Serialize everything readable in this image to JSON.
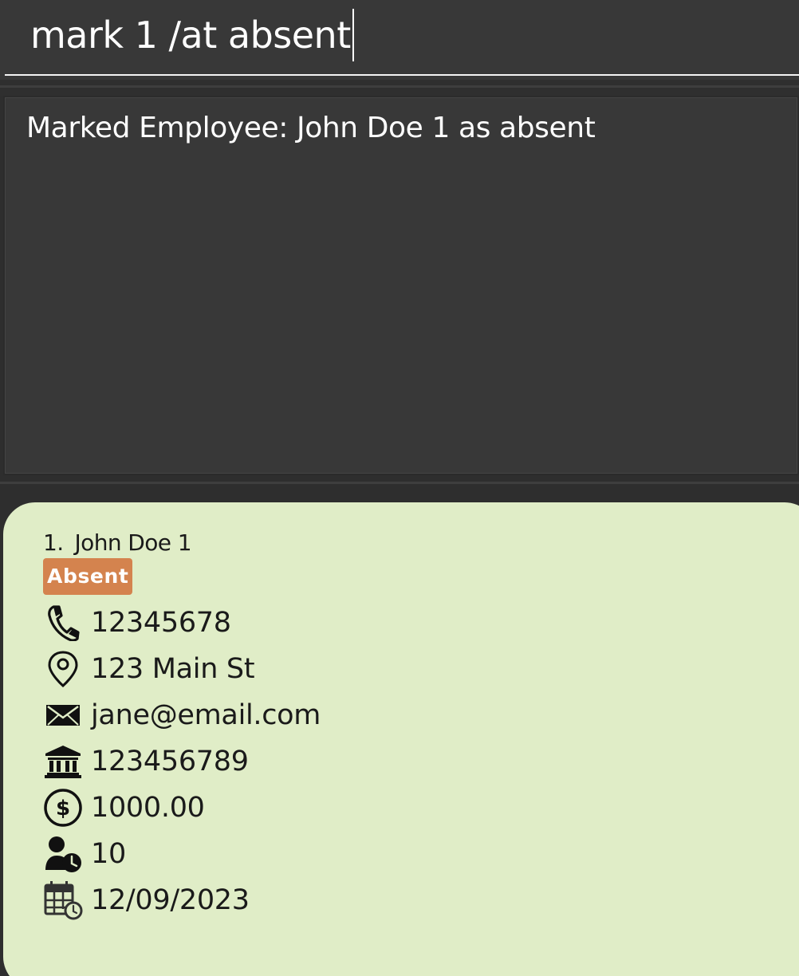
{
  "command": {
    "value": "mark 1 /at absent"
  },
  "result": {
    "message": "Marked Employee: John Doe 1 as absent"
  },
  "employee": {
    "index": "1.",
    "name": "John Doe 1",
    "status": "Absent",
    "status_color": "#d4834e",
    "card_color": "#e0edc7",
    "phone": "12345678",
    "address": "123 Main St",
    "email": "jane@email.com",
    "bank_account": "123456789",
    "salary": "1000.00",
    "leave": "10",
    "date": "12/09/2023"
  },
  "icons": {
    "phone": "phone-icon",
    "address": "location-pin-icon",
    "email": "envelope-icon",
    "bank": "bank-icon",
    "salary": "dollar-icon",
    "leave": "person-clock-icon",
    "date": "calendar-clock-icon"
  }
}
